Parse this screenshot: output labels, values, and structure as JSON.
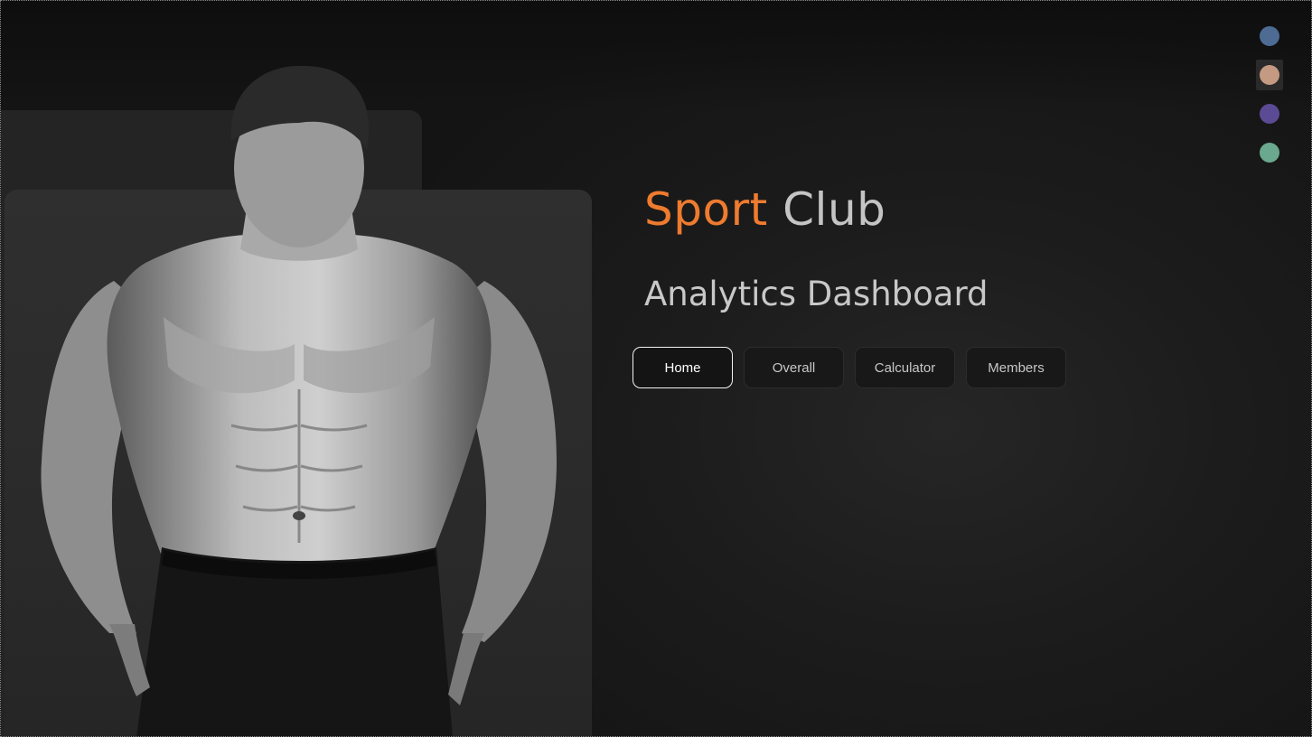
{
  "header": {
    "title_word1": "Sport",
    "title_word2": "Club",
    "subtitle": "Analytics Dashboard"
  },
  "nav": {
    "items": [
      "Home",
      "Overall",
      "Calculator",
      "Members"
    ],
    "active": "Home"
  },
  "theme_picker": {
    "colors": [
      "#4d6b93",
      "#c49a82",
      "#5b4b94",
      "#6aa88f"
    ],
    "selected_index": 1
  },
  "colors": {
    "accent": "#ee7b2f",
    "background": "#151515",
    "text_muted": "#c4c4c4"
  },
  "hero_image": {
    "icon": "athlete-photo"
  }
}
